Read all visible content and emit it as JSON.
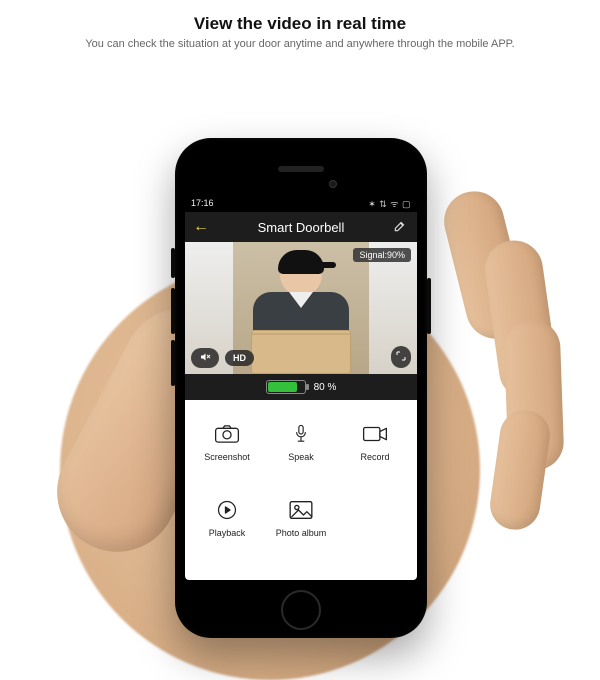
{
  "promo": {
    "title": "View the video in real time",
    "subtitle": "You can check the situation at your door anytime and anywhere through the mobile APP."
  },
  "statusbar": {
    "time": "17:16",
    "right_icons": "✶ ⇅ ᯤ ▢"
  },
  "header": {
    "title": "Smart Doorbell"
  },
  "video": {
    "overlay_text": "",
    "signal_label": "Signal:90%",
    "hd_label": "HD"
  },
  "battery": {
    "percent_label": "80 %",
    "fill_pct": 80
  },
  "actions": [
    {
      "key": "screenshot",
      "label": "Screenshot"
    },
    {
      "key": "speak",
      "label": "Speak"
    },
    {
      "key": "record",
      "label": "Record"
    },
    {
      "key": "playback",
      "label": "Playback"
    },
    {
      "key": "photo-album",
      "label": "Photo album"
    }
  ]
}
